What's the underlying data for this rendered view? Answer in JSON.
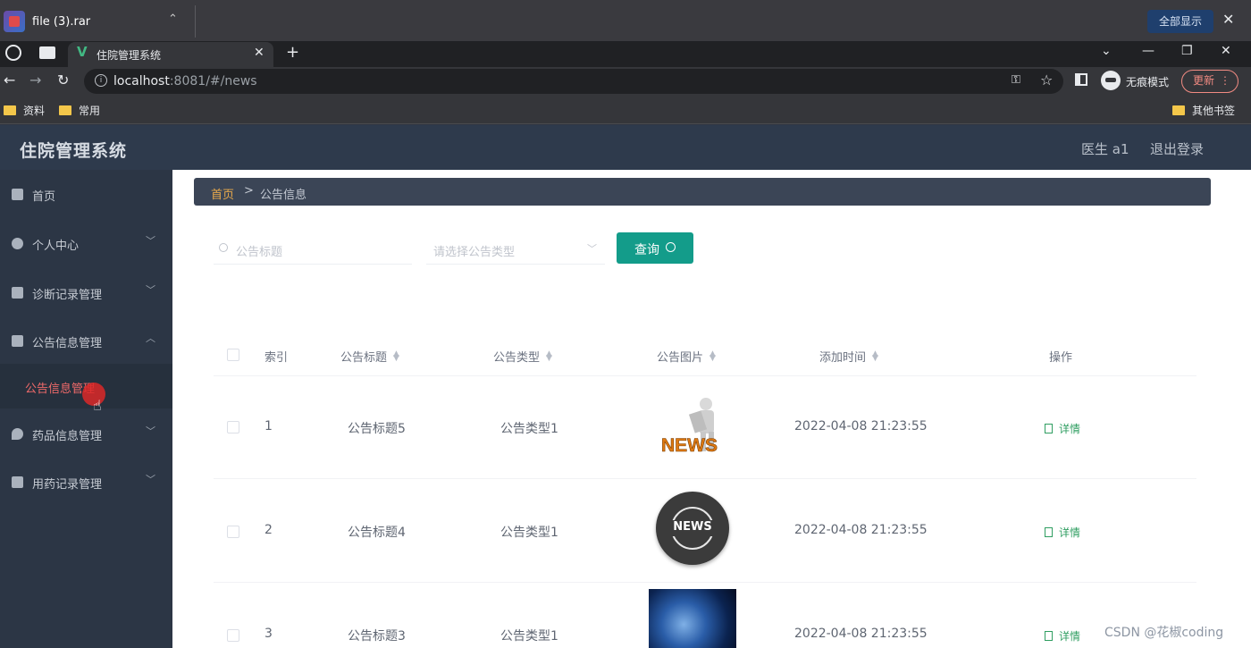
{
  "download_bar": {
    "file_name": "file (3).rar",
    "show_all": "全部显示"
  },
  "tabbar": {
    "tab_title": "住院管理系统"
  },
  "address_bar": {
    "host": "localhost",
    "path": ":8081/#/news",
    "incognito_label": "无痕模式",
    "update_label": "更新"
  },
  "bookmarks": {
    "items": [
      "资料",
      "常用"
    ],
    "other": "其他书签"
  },
  "app": {
    "title": "住院管理系统",
    "user": "医生 a1",
    "logout": "退出登录"
  },
  "sidebar": {
    "items": [
      {
        "label": "首页",
        "icon": "home-icon"
      },
      {
        "label": "个人中心",
        "icon": "user-icon"
      },
      {
        "label": "诊断记录管理",
        "icon": "chat-icon"
      },
      {
        "label": "公告信息管理",
        "icon": "notice-icon"
      },
      {
        "label": "药品信息管理",
        "icon": "pill-icon"
      },
      {
        "label": "用药记录管理",
        "icon": "clipboard-icon"
      }
    ],
    "active_sub": "公告信息管理"
  },
  "breadcrumb": {
    "home": "首页",
    "separator": ">",
    "current": "公告信息"
  },
  "search": {
    "title_placeholder": "公告标题",
    "type_placeholder": "请选择公告类型",
    "query_label": "查询"
  },
  "table": {
    "headers": [
      "索引",
      "公告标题",
      "公告类型",
      "公告图片",
      "添加时间",
      "操作"
    ],
    "rows": [
      {
        "index": "1",
        "title": "公告标题5",
        "type": "公告类型1",
        "time": "2022-04-08 21:23:55",
        "action": "详情"
      },
      {
        "index": "2",
        "title": "公告标题4",
        "type": "公告类型1",
        "time": "2022-04-08 21:23:55",
        "action": "详情"
      },
      {
        "index": "3",
        "title": "公告标题3",
        "type": "公告类型1",
        "time": "2022-04-08 21:23:55",
        "action": "详情"
      }
    ],
    "image_texts": [
      "NEWS",
      "NEWS"
    ]
  },
  "watermark": "CSDN @花椒coding",
  "colors": {
    "accent": "#139c8a",
    "header_bg": "#2e3a4c",
    "sidebar_bg": "#2c3645",
    "active_sub": "#f06a6a",
    "detail": "#2f9e61"
  }
}
